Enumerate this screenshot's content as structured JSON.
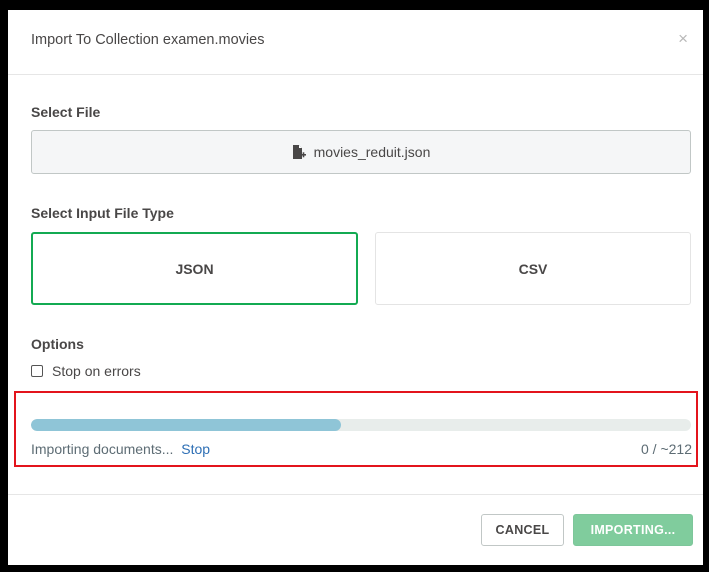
{
  "dialog": {
    "title": "Import To Collection examen.movies",
    "close_glyph": "×"
  },
  "select_file": {
    "label": "Select File",
    "file_name": "movies_reduit.json",
    "icon": "file-icon"
  },
  "file_type": {
    "label": "Select Input File Type",
    "options": [
      {
        "label": "JSON",
        "selected": true
      },
      {
        "label": "CSV",
        "selected": false
      }
    ]
  },
  "options": {
    "label": "Options",
    "stop_on_errors": {
      "label": "Stop on errors",
      "checked": false
    }
  },
  "progress": {
    "fraction": 0.47,
    "status": "Importing documents...",
    "stop_label": "Stop",
    "count": "0 / ~212"
  },
  "footer": {
    "cancel_label": "CANCEL",
    "import_label": "IMPORTING..."
  },
  "colors": {
    "selected_border": "#13aa52",
    "progress_fill": "#8fc5d7",
    "highlight_border": "#e3141c",
    "import_button": "#80cc9d",
    "link": "#2e6fb5"
  }
}
